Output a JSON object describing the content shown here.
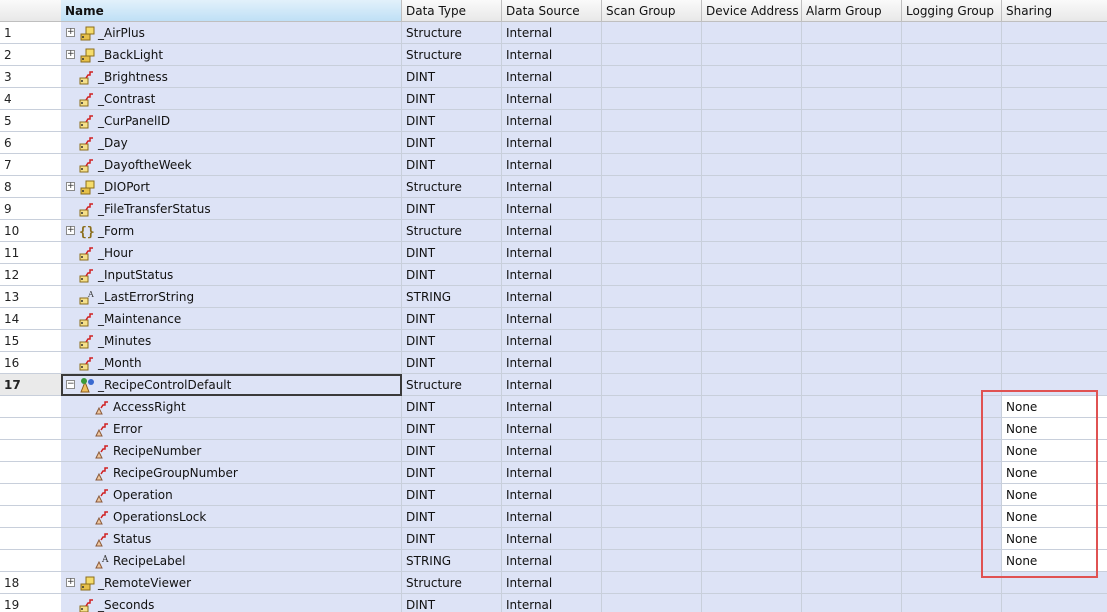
{
  "columns": {
    "name": "Name",
    "data_type": "Data Type",
    "data_source": "Data Source",
    "scan_group": "Scan Group",
    "device_address": "Device Address",
    "alarm_group": "Alarm Group",
    "logging_group": "Logging Group",
    "sharing": "Sharing"
  },
  "rows": [
    {
      "num": "1",
      "name": "_AirPlus",
      "type": "Structure",
      "source": "Internal",
      "sharing": "",
      "level": 0,
      "expander": "+",
      "icon": "folder-tag-icon"
    },
    {
      "num": "2",
      "name": "_BackLight",
      "type": "Structure",
      "source": "Internal",
      "sharing": "",
      "level": 0,
      "expander": "+",
      "icon": "folder-tag-icon"
    },
    {
      "num": "3",
      "name": "_Brightness",
      "type": "DINT",
      "source": "Internal",
      "sharing": "",
      "level": 0,
      "expander": "",
      "icon": "integer-tag-icon"
    },
    {
      "num": "4",
      "name": "_Contrast",
      "type": "DINT",
      "source": "Internal",
      "sharing": "",
      "level": 0,
      "expander": "",
      "icon": "integer-tag-icon"
    },
    {
      "num": "5",
      "name": "_CurPanelID",
      "type": "DINT",
      "source": "Internal",
      "sharing": "",
      "level": 0,
      "expander": "",
      "icon": "integer-tag-icon"
    },
    {
      "num": "6",
      "name": "_Day",
      "type": "DINT",
      "source": "Internal",
      "sharing": "",
      "level": 0,
      "expander": "",
      "icon": "integer-tag-icon"
    },
    {
      "num": "7",
      "name": "_DayoftheWeek",
      "type": "DINT",
      "source": "Internal",
      "sharing": "",
      "level": 0,
      "expander": "",
      "icon": "integer-tag-icon"
    },
    {
      "num": "8",
      "name": "_DIOPort",
      "type": "Structure",
      "source": "Internal",
      "sharing": "",
      "level": 0,
      "expander": "+",
      "icon": "folder-tag-icon"
    },
    {
      "num": "9",
      "name": "_FileTransferStatus",
      "type": "DINT",
      "source": "Internal",
      "sharing": "",
      "level": 0,
      "expander": "",
      "icon": "integer-tag-icon"
    },
    {
      "num": "10",
      "name": "_Form",
      "type": "Structure",
      "source": "Internal",
      "sharing": "",
      "level": 0,
      "expander": "+",
      "icon": "braces-icon"
    },
    {
      "num": "11",
      "name": "_Hour",
      "type": "DINT",
      "source": "Internal",
      "sharing": "",
      "level": 0,
      "expander": "",
      "icon": "integer-tag-icon"
    },
    {
      "num": "12",
      "name": "_InputStatus",
      "type": "DINT",
      "source": "Internal",
      "sharing": "",
      "level": 0,
      "expander": "",
      "icon": "integer-tag-icon"
    },
    {
      "num": "13",
      "name": "_LastErrorString",
      "type": "STRING",
      "source": "Internal",
      "sharing": "",
      "level": 0,
      "expander": "",
      "icon": "string-tag-icon"
    },
    {
      "num": "14",
      "name": "_Maintenance",
      "type": "DINT",
      "source": "Internal",
      "sharing": "",
      "level": 0,
      "expander": "",
      "icon": "integer-tag-icon"
    },
    {
      "num": "15",
      "name": "_Minutes",
      "type": "DINT",
      "source": "Internal",
      "sharing": "",
      "level": 0,
      "expander": "",
      "icon": "integer-tag-icon"
    },
    {
      "num": "16",
      "name": "_Month",
      "type": "DINT",
      "source": "Internal",
      "sharing": "",
      "level": 0,
      "expander": "",
      "icon": "integer-tag-icon"
    },
    {
      "num": "17",
      "name": "_RecipeControlDefault",
      "type": "Structure",
      "source": "Internal",
      "sharing": "",
      "level": 0,
      "expander": "−",
      "icon": "recipe-structure-icon",
      "selected": true
    },
    {
      "num": "",
      "name": "AccessRight",
      "type": "DINT",
      "source": "Internal",
      "sharing": "None",
      "level": 1,
      "expander": "",
      "icon": "member-integer-icon"
    },
    {
      "num": "",
      "name": "Error",
      "type": "DINT",
      "source": "Internal",
      "sharing": "None",
      "level": 1,
      "expander": "",
      "icon": "member-integer-icon"
    },
    {
      "num": "",
      "name": "RecipeNumber",
      "type": "DINT",
      "source": "Internal",
      "sharing": "None",
      "level": 1,
      "expander": "",
      "icon": "member-integer-icon"
    },
    {
      "num": "",
      "name": "RecipeGroupNumber",
      "type": "DINT",
      "source": "Internal",
      "sharing": "None",
      "level": 1,
      "expander": "",
      "icon": "member-integer-icon"
    },
    {
      "num": "",
      "name": "Operation",
      "type": "DINT",
      "source": "Internal",
      "sharing": "None",
      "level": 1,
      "expander": "",
      "icon": "member-integer-icon"
    },
    {
      "num": "",
      "name": "OperationsLock",
      "type": "DINT",
      "source": "Internal",
      "sharing": "None",
      "level": 1,
      "expander": "",
      "icon": "member-integer-icon"
    },
    {
      "num": "",
      "name": "Status",
      "type": "DINT",
      "source": "Internal",
      "sharing": "None",
      "level": 1,
      "expander": "",
      "icon": "member-integer-icon"
    },
    {
      "num": "",
      "name": "RecipeLabel",
      "type": "STRING",
      "source": "Internal",
      "sharing": "None",
      "level": 1,
      "expander": "",
      "icon": "member-string-icon"
    },
    {
      "num": "18",
      "name": "_RemoteViewer",
      "type": "Structure",
      "source": "Internal",
      "sharing": "",
      "level": 0,
      "expander": "+",
      "icon": "folder-tag-icon"
    },
    {
      "num": "19",
      "name": "_Seconds",
      "type": "DINT",
      "source": "Internal",
      "sharing": "",
      "level": 0,
      "expander": "",
      "icon": "integer-tag-icon"
    }
  ],
  "colors": {
    "row_bg": "#dde3f6",
    "highlight_border": "#e05252",
    "header_name_bg": "#bfe0f6"
  }
}
